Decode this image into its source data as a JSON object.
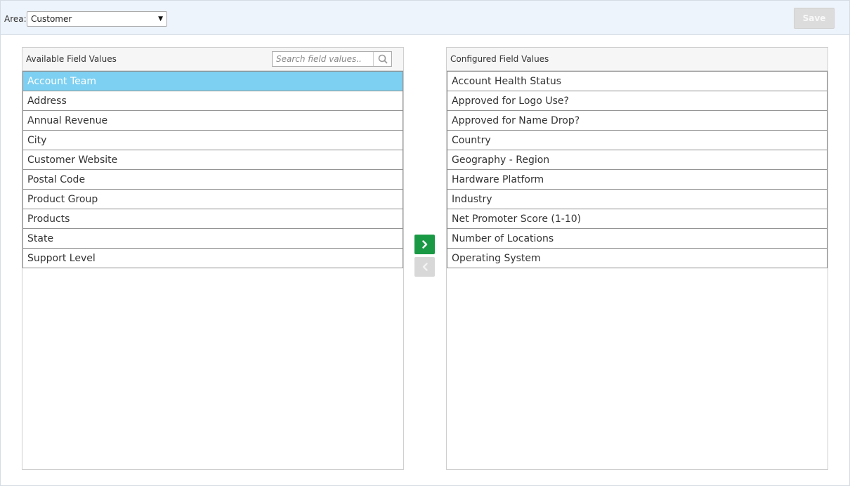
{
  "toolbar": {
    "area_label": "Area:",
    "area_value": "Customer",
    "save_label": "Save"
  },
  "available": {
    "title": "Available Field Values",
    "search_placeholder": "Search field values..",
    "items": [
      {
        "label": "Account Team"
      },
      {
        "label": "Address"
      },
      {
        "label": "Annual Revenue"
      },
      {
        "label": "City"
      },
      {
        "label": "Customer Website"
      },
      {
        "label": "Postal Code"
      },
      {
        "label": "Product Group"
      },
      {
        "label": "Products"
      },
      {
        "label": "State"
      },
      {
        "label": "Support Level"
      }
    ],
    "selected": "Account Team"
  },
  "configured": {
    "title": "Configured Field Values",
    "items": [
      {
        "label": "Account Health Status"
      },
      {
        "label": "Approved for Logo Use?"
      },
      {
        "label": "Approved for Name Drop?"
      },
      {
        "label": "Country"
      },
      {
        "label": "Geography - Region"
      },
      {
        "label": "Hardware Platform"
      },
      {
        "label": "Industry"
      },
      {
        "label": "Net Promoter Score (1-10)"
      },
      {
        "label": "Number of Locations"
      },
      {
        "label": "Operating System"
      }
    ]
  },
  "colors": {
    "selected_row": "#7dd0f1",
    "move_right_active": "#1a9945",
    "move_left_disabled": "#d8d8d8"
  },
  "icons": {
    "move_right": "chevron-right-icon",
    "move_left": "chevron-left-icon",
    "search": "search-icon",
    "dropdown": "caret-down-icon"
  }
}
